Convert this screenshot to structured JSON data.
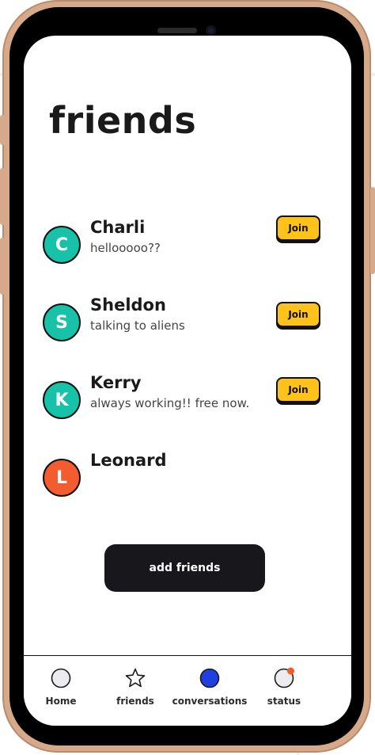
{
  "page": {
    "title": "friends"
  },
  "colors": {
    "frame": "#d6a98a",
    "teal": "#17c2a8",
    "orange": "#f25c2e",
    "join_yellow": "#ffc21a",
    "nav_active": "#1f3fe0",
    "notification": "#f25c2e",
    "button_dark": "#18181c"
  },
  "friends": [
    {
      "initial": "C",
      "name": "Charli",
      "status": "hellooooo??",
      "avatar_color": "#17c2a8",
      "join_label": "Join"
    },
    {
      "initial": "S",
      "name": "Sheldon",
      "status": "talking to aliens",
      "avatar_color": "#17c2a8",
      "join_label": "Join"
    },
    {
      "initial": "K",
      "name": "Kerry",
      "status": "always working!! free now.",
      "avatar_color": "#17c2a8",
      "join_label": "Join"
    },
    {
      "initial": "L",
      "name": "Leonard",
      "status": "",
      "avatar_color": "#f25c2e",
      "join_label": ""
    }
  ],
  "actions": {
    "add_friends_label": "add friends"
  },
  "nav": {
    "items": [
      {
        "label": "Home",
        "icon": "circle-icon",
        "active": false
      },
      {
        "label": "friends",
        "icon": "star-icon",
        "active": false
      },
      {
        "label": "conversations",
        "icon": "filled-circle-icon",
        "active": true
      },
      {
        "label": "status",
        "icon": "status-icon",
        "active": false,
        "has_notification": true
      }
    ]
  }
}
